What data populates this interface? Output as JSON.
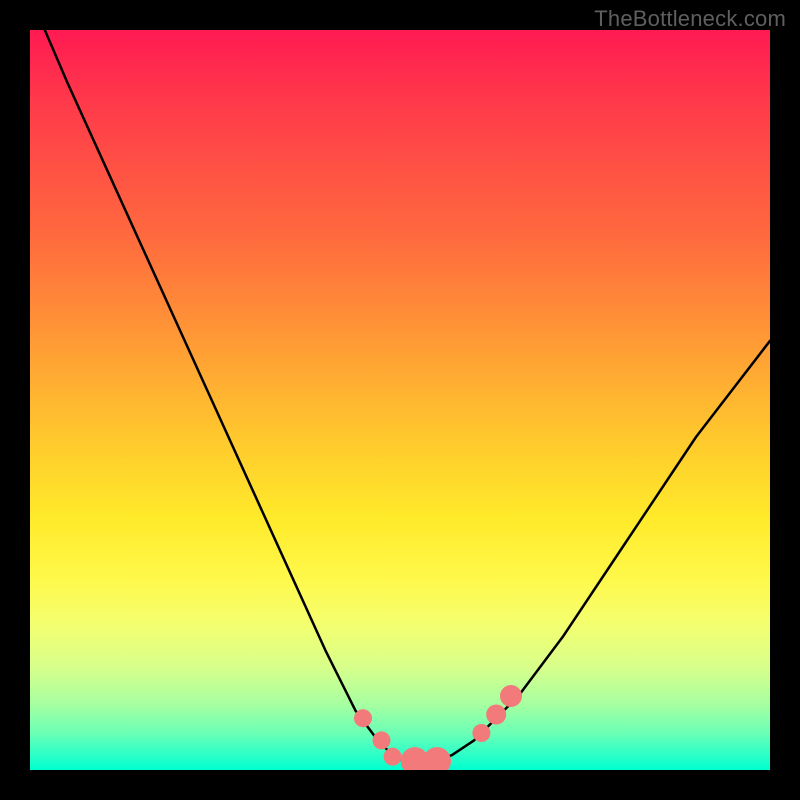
{
  "watermark": "TheBottleneck.com",
  "chart_data": {
    "type": "line",
    "title": "",
    "xlabel": "",
    "ylabel": "",
    "x_range": [
      0,
      1
    ],
    "y_range": [
      0,
      1
    ],
    "series": [
      {
        "name": "bottleneck_curve",
        "x": [
          0.02,
          0.05,
          0.1,
          0.15,
          0.2,
          0.25,
          0.3,
          0.35,
          0.4,
          0.44,
          0.47,
          0.49,
          0.51,
          0.54,
          0.57,
          0.6,
          0.62,
          0.66,
          0.72,
          0.8,
          0.9,
          1.0
        ],
        "y": [
          1.0,
          0.93,
          0.82,
          0.71,
          0.6,
          0.49,
          0.38,
          0.27,
          0.16,
          0.08,
          0.04,
          0.02,
          0.01,
          0.01,
          0.02,
          0.04,
          0.06,
          0.1,
          0.18,
          0.3,
          0.45,
          0.58
        ]
      }
    ],
    "markers": [
      {
        "x": 0.45,
        "y": 0.07,
        "r": 9
      },
      {
        "x": 0.475,
        "y": 0.04,
        "r": 9
      },
      {
        "x": 0.49,
        "y": 0.018,
        "r": 9
      },
      {
        "x": 0.52,
        "y": 0.012,
        "r": 14
      },
      {
        "x": 0.55,
        "y": 0.012,
        "r": 14
      },
      {
        "x": 0.61,
        "y": 0.05,
        "r": 9
      },
      {
        "x": 0.63,
        "y": 0.075,
        "r": 10
      },
      {
        "x": 0.65,
        "y": 0.1,
        "r": 11
      }
    ],
    "gradient_stops": [
      {
        "offset": 0.0,
        "color": "#ff1a52"
      },
      {
        "offset": 0.28,
        "color": "#ff6a3e"
      },
      {
        "offset": 0.55,
        "color": "#ffc82d"
      },
      {
        "offset": 0.74,
        "color": "#fff84a"
      },
      {
        "offset": 0.91,
        "color": "#a8ffa0"
      },
      {
        "offset": 1.0,
        "color": "#00ffd0"
      }
    ],
    "marker_color": "#f27a7a",
    "curve_color": "#000000"
  }
}
